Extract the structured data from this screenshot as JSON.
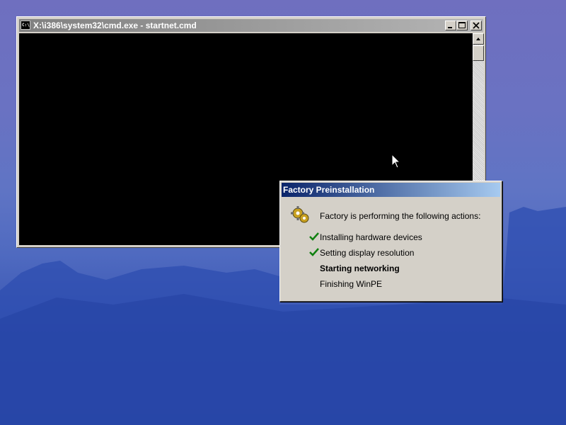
{
  "cmd_window": {
    "title": "X:\\i386\\system32\\cmd.exe - startnet.cmd",
    "icon_text": "C:\\",
    "minimize_icon": "minimize-icon",
    "maximize_icon": "maximize-icon",
    "close_icon": "close-icon"
  },
  "dialog": {
    "title": "Factory Preinstallation",
    "message": "Factory is performing the following actions:",
    "actions": [
      {
        "label": "Installing hardware devices",
        "status": "done"
      },
      {
        "label": "Setting display resolution",
        "status": "done"
      },
      {
        "label": "Starting networking",
        "status": "in-progress"
      },
      {
        "label": "Finishing WinPE",
        "status": "pending"
      }
    ]
  },
  "colors": {
    "dialog_title_start": "#0a246a",
    "dialog_title_end": "#a6caf0",
    "check": "#108010"
  }
}
